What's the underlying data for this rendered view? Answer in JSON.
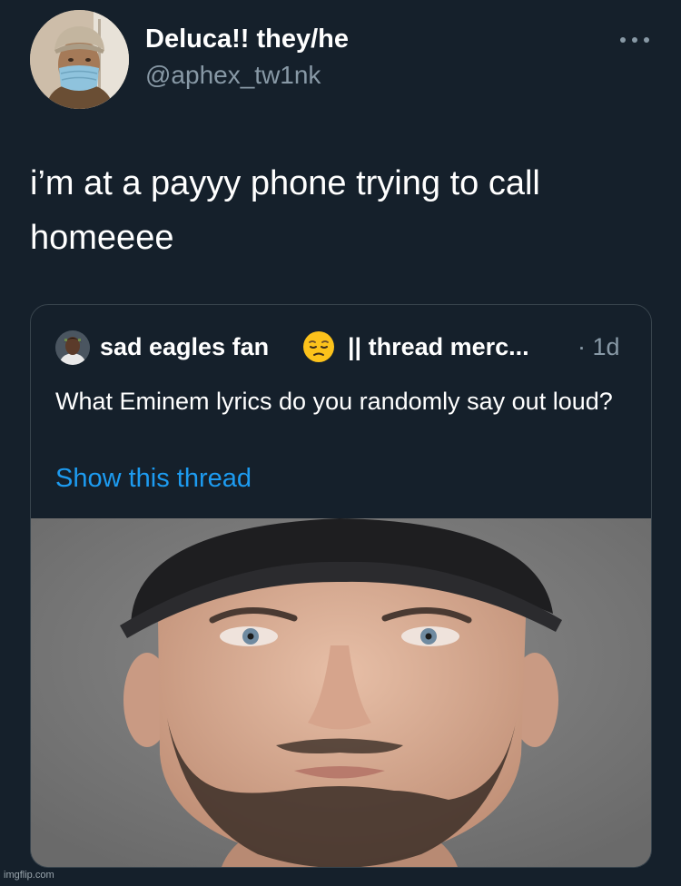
{
  "author": {
    "display_name": "Deluca!! they/he",
    "handle": "@aphex_tw1nk",
    "avatar_icon": "profile-photo-masked-person"
  },
  "more_icon": "more-horizontal-icon",
  "tweet": {
    "text": "i’m at a payyy phone trying to call homeeee"
  },
  "quoted_tweet": {
    "display_name": "sad eagles fan",
    "emoji": "pensive-face-emoji",
    "display_name_rest": "|| thread merc...",
    "time": "· 1d",
    "text": "What Eminem lyrics do you randomly say out loud?",
    "show_thread": "Show this thread",
    "image_subject": "close-up portrait of a bearded man in a black cap"
  },
  "colors": {
    "background": "#15202b",
    "secondary_text": "#8899a6",
    "link": "#1d9bf0",
    "border": "#38444d"
  },
  "watermark": "imgflip.com"
}
